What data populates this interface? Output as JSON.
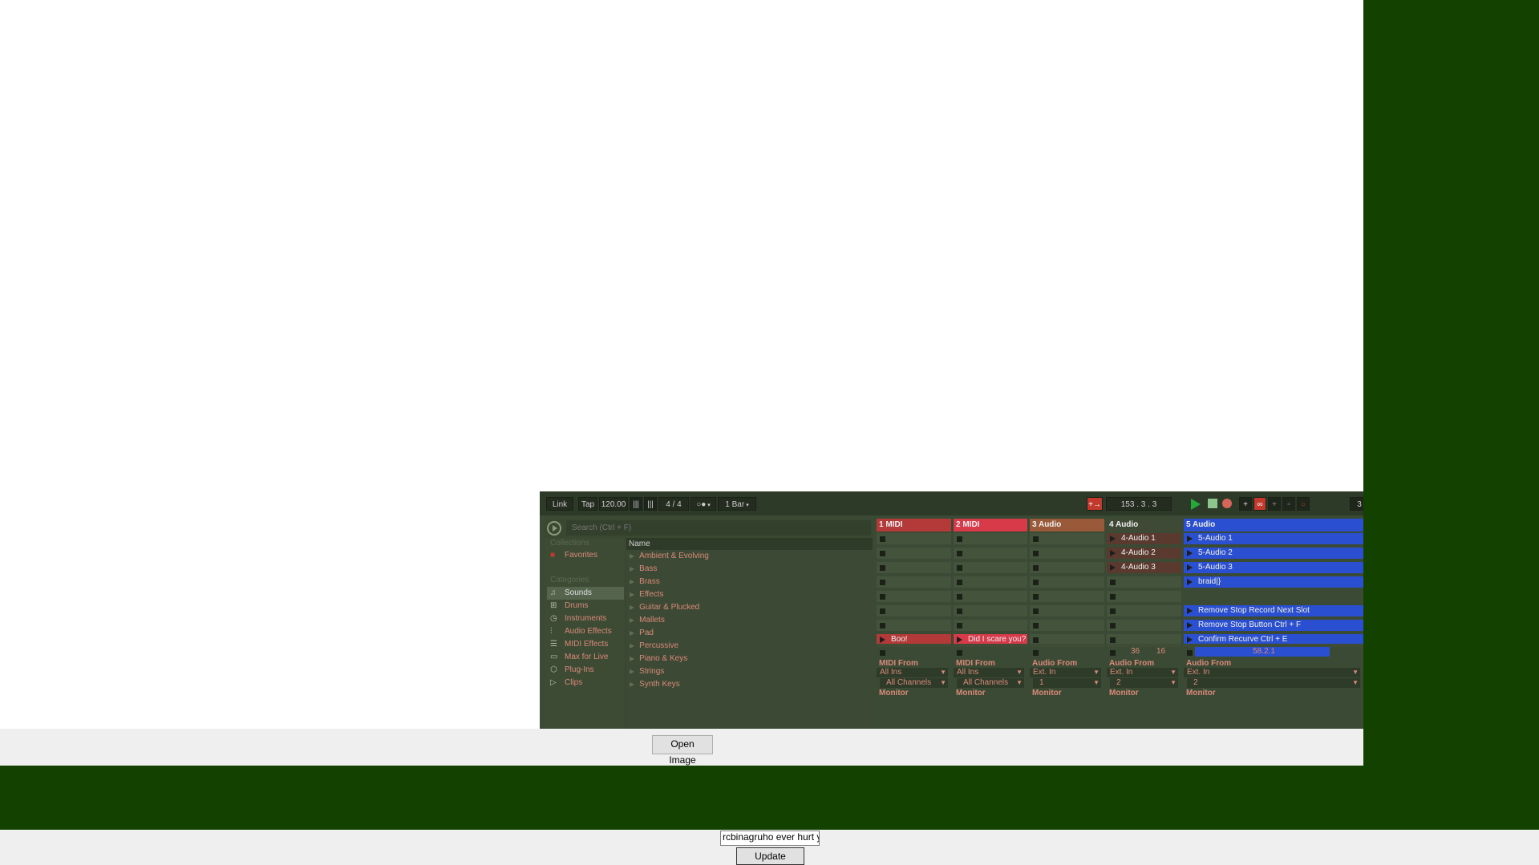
{
  "toolbar": {
    "link": "Link",
    "tap": "Tap",
    "tempo": "120.00",
    "signature": "4 / 4",
    "quantize": "1 Bar",
    "position": [
      "153",
      "3",
      "3"
    ]
  },
  "browser": {
    "search_placeholder": "Search (Ctrl + F)",
    "collections_heading": "Collections",
    "favorites": "Favorites",
    "categories_heading": "Categories",
    "categories": [
      "Sounds",
      "Drums",
      "Instruments",
      "Audio Effects",
      "MIDI Effects",
      "Max for Live",
      "Plug-Ins",
      "Clips"
    ],
    "name_header": "Name",
    "names": [
      "Ambient & Evolving",
      "Bass",
      "Brass",
      "Effects",
      "Guitar & Plucked",
      "Mallets",
      "Pad",
      "Percussive",
      "Piano & Keys",
      "Strings",
      "Synth Keys"
    ]
  },
  "tracks": [
    {
      "name": "1 MIDI",
      "color": "#b33a38"
    },
    {
      "name": "2 MIDI",
      "color": "#d83a4a"
    },
    {
      "name": "3 Audio",
      "color": "#9a5a3a"
    },
    {
      "name": "4 Audio",
      "color": "#3f4a36"
    },
    {
      "name": "5 Audio",
      "color": "#2a4fd0"
    }
  ],
  "clips": {
    "t1_slot8": "Boo!",
    "t2_slot8": "Did I scare you?",
    "t4": [
      "4-Audio 1",
      "4-Audio 2",
      "4-Audio 3"
    ],
    "t5": [
      "5-Audio 1",
      "5-Audio 2",
      "5-Audio 3",
      "braid|}",
      "",
      "Remove Stop Record Next Slot",
      "Remove Stop Button Ctrl + F",
      "Confirm Recurve Ctrl + E"
    ]
  },
  "mixer": {
    "t4_values": [
      "36",
      "16"
    ],
    "t5_value": "58.2.1"
  },
  "io": {
    "midi_from": "MIDI From",
    "audio_from": "Audio From",
    "all_ins": "All Ins",
    "ext_in": "Ext. In",
    "all_channels": "All Channels",
    "ch1": "1",
    "ch2": "2",
    "monitor": "Monitor"
  },
  "panel": {
    "open_image": "Open Image",
    "text_value": "rcbinagruho ever hurt y",
    "update_output": "Update Output"
  }
}
